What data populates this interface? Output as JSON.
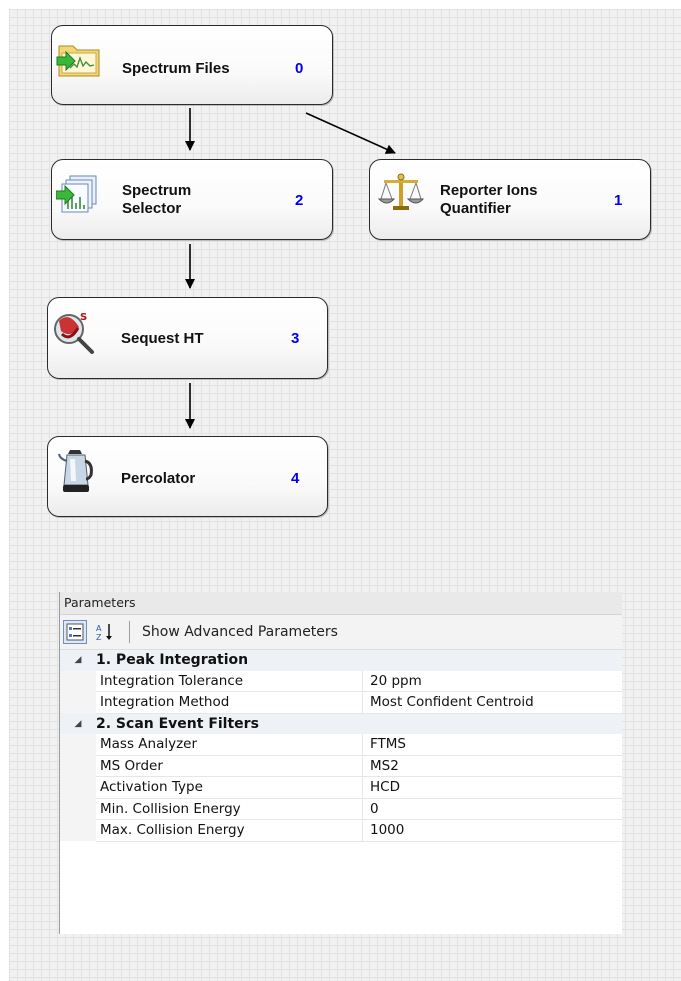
{
  "workflow": {
    "nodes": [
      {
        "id": "spectrum-files",
        "label": "Spectrum Files",
        "number": "0",
        "icon": "spectrum-files-icon"
      },
      {
        "id": "spectrum-selector",
        "label": "Spectrum\nSelector",
        "number": "2",
        "icon": "spectrum-selector-icon"
      },
      {
        "id": "reporter-ions",
        "label": "Reporter Ions\nQuantifier",
        "number": "1",
        "icon": "balance-scale-icon"
      },
      {
        "id": "sequest",
        "label": "Sequest HT",
        "number": "3",
        "icon": "sequest-icon"
      },
      {
        "id": "percolator",
        "label": "Percolator",
        "number": "4",
        "icon": "coffee-percolator-icon"
      }
    ]
  },
  "parameters": {
    "title": "Parameters",
    "toolbar": {
      "categorized_icon": "categorized-view-icon",
      "alphabetical_icon": "sort-alphabetical-icon",
      "advanced_label": "Show Advanced Parameters"
    },
    "categories": [
      {
        "name": "1. Peak Integration",
        "expander": "◢",
        "rows": [
          {
            "name": "Integration Tolerance",
            "value": "20 ppm"
          },
          {
            "name": "Integration Method",
            "value": "Most Confident Centroid"
          }
        ]
      },
      {
        "name": "2. Scan Event Filters",
        "expander": "◢",
        "rows": [
          {
            "name": "Mass Analyzer",
            "value": "FTMS"
          },
          {
            "name": "MS Order",
            "value": "MS2"
          },
          {
            "name": "Activation Type",
            "value": "HCD"
          },
          {
            "name": "Min. Collision Energy",
            "value": "0"
          },
          {
            "name": "Max. Collision Energy",
            "value": "1000"
          }
        ]
      }
    ]
  },
  "colors": {
    "node_number": "#0000ee",
    "canvas": "#f1f1f1",
    "category_row": "#eef1f6"
  }
}
